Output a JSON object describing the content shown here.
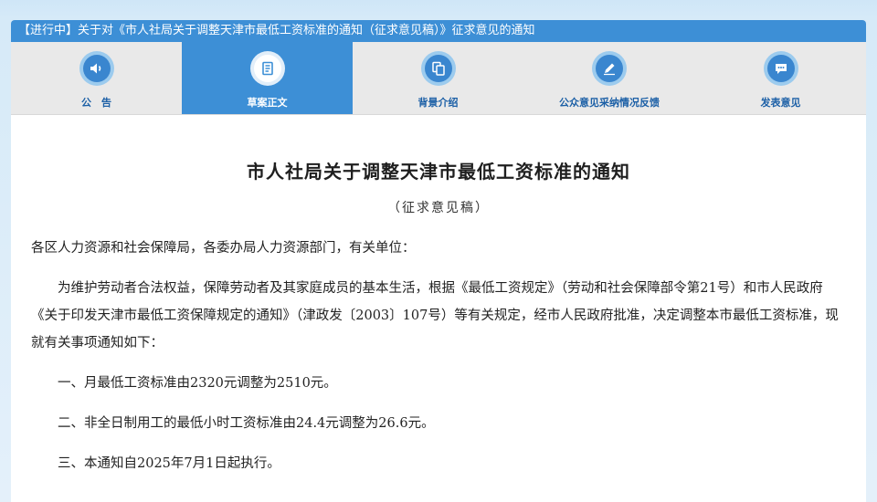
{
  "header": {
    "title": "【进行中】关于对《市人社局关于调整天津市最低工资标准的通知（征求意见稿）》征求意见的通知"
  },
  "tabs": [
    {
      "label": "公　告",
      "icon": "speaker-icon"
    },
    {
      "label": "草案正文",
      "icon": "document-icon"
    },
    {
      "label": "背景介绍",
      "icon": "copy-icon"
    },
    {
      "label": "公众意见采纳情况反馈",
      "icon": "pen-icon"
    },
    {
      "label": "发表意见",
      "icon": "chat-bubble-icon"
    }
  ],
  "active_tab": 1,
  "document": {
    "title": "市人社局关于调整天津市最低工资标准的通知",
    "subtitle": "（征求意见稿）",
    "salutation": "各区人力资源和社会保障局，各委办局人力资源部门，有关单位：",
    "intro": "为维护劳动者合法权益，保障劳动者及其家庭成员的基本生活，根据《最低工资规定》（劳动和社会保障部令第21号）和市人民政府《关于印发天津市最低工资保障规定的通知》（津政发〔2003〕107号）等有关规定，经市人民政府批准，决定调整本市最低工资标准，现就有关事项通知如下：",
    "items": [
      "一、月最低工资标准由2320元调整为2510元。",
      "二、非全日制用工的最低小时工资标准由24.4元调整为26.6元。",
      "三、本通知自2025年7月1日起执行。"
    ]
  },
  "colors": {
    "accent": "#3d8fd6",
    "tab_bar": "#e9e9e9",
    "tab_text": "#1b5fa6",
    "background": "#d6eaf8"
  }
}
